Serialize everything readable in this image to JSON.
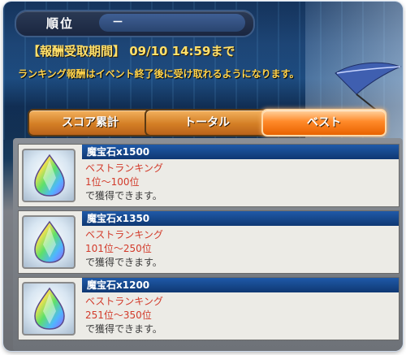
{
  "header": {
    "rank_label": "順位",
    "rank_value": "－",
    "reward_period": "【報酬受取期間】 09/10 14:59まで",
    "notice": "ランキング報酬はイベント終了後に受け取れるようになります。"
  },
  "tabs": [
    {
      "label": "スコア累計",
      "active": false
    },
    {
      "label": "トータル",
      "active": false
    },
    {
      "label": "ベスト",
      "active": true
    }
  ],
  "rewards": [
    {
      "name": "魔宝石x1500",
      "category": "ベストランキング",
      "range": "1位～100位",
      "note": "で獲得できます。"
    },
    {
      "name": "魔宝石x1350",
      "category": "ベストランキング",
      "range": "101位～250位",
      "note": "で獲得できます。"
    },
    {
      "name": "魔宝石x1200",
      "category": "ベストランキング",
      "range": "251位～350位",
      "note": "で獲得できます。"
    }
  ],
  "icons": {
    "reward_item": "rainbow-gem-icon",
    "decoration": "feather-quill-icon"
  },
  "colors": {
    "accent_orange": "#ff8a2a",
    "title_blue": "#1f5aa8",
    "highlight_red": "#d23a2a",
    "period_yellow": "#ffe06b"
  }
}
